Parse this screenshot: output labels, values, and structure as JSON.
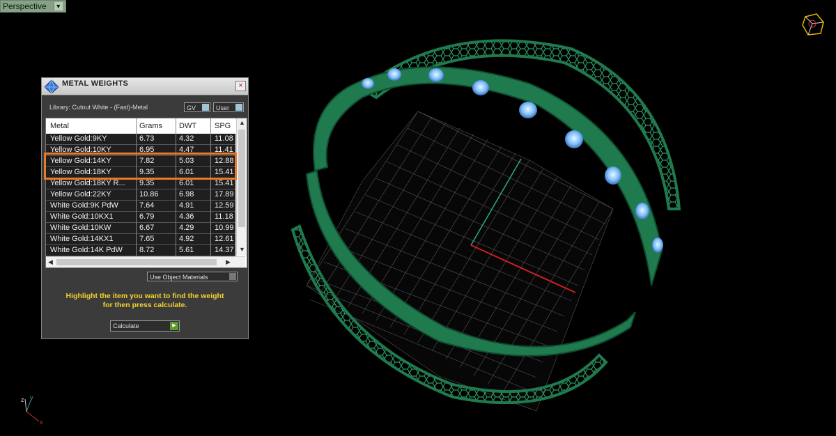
{
  "viewport": {
    "tab_label": "Perspective",
    "tab_arrow": "▼"
  },
  "panel": {
    "title": "METAL WEIGHTS",
    "close_glyph": "×",
    "library": "Library: Cutout White - (Fast)-Metal",
    "dropdown1": "GV",
    "dropdown2": "User",
    "columns": [
      "Metal",
      "Grams",
      "DWT",
      "SPG"
    ],
    "rows": [
      [
        "Yellow Gold:9KY",
        "6.73",
        "4.32",
        "11.08"
      ],
      [
        "Yellow Gold:10KY",
        "6.95",
        "4.47",
        "11.41"
      ],
      [
        "Yellow Gold:14KY",
        "7.82",
        "5.03",
        "12.88"
      ],
      [
        "Yellow Gold:18KY",
        "9.35",
        "6.01",
        "15.41"
      ],
      [
        "Yellow Gold:18KY R...",
        "9.35",
        "6.01",
        "15.41"
      ],
      [
        "Yellow Gold:22KY",
        "10.86",
        "6.98",
        "17.89"
      ],
      [
        "White Gold:9K PdW",
        "7.64",
        "4.91",
        "12.59"
      ],
      [
        "White Gold:10KX1",
        "6.79",
        "4.36",
        "11.18"
      ],
      [
        "White Gold:10KW",
        "6.67",
        "4.29",
        "10.99"
      ],
      [
        "White Gold:14KX1",
        "7.65",
        "4.92",
        "12.61"
      ],
      [
        "White Gold:14K PdW",
        "8.72",
        "5.61",
        "14.37"
      ]
    ],
    "object_materials": "Use Object Materials",
    "message_line1": "Highlight the item you want to find the weight",
    "message_line2": "for then press calculate.",
    "calculate_label": "Calculate"
  },
  "axis": {
    "x": "x",
    "y": "y",
    "z": "z"
  },
  "colors": {
    "ring_green": "#1f7a4e",
    "highlight": "#e87a2a",
    "message": "#f4d22c",
    "gem": "#8ec9ff"
  },
  "icons": {
    "logo": "gem-logo-icon",
    "close": "close-icon",
    "nav": "navigation-cube-icon",
    "axis": "axis-triad-icon"
  }
}
